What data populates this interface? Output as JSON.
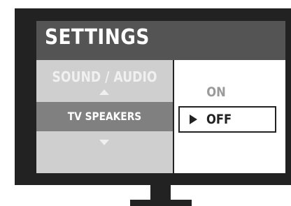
{
  "header": {
    "title": "SETTINGS"
  },
  "menu": {
    "category": "SOUND / AUDIO",
    "selected_item": "TV SPEAKERS",
    "scroll_up_icon": "triangle-up-icon",
    "scroll_down_icon": "triangle-down-icon"
  },
  "options": {
    "items": [
      {
        "label": "ON",
        "selected": false
      },
      {
        "label": "OFF",
        "selected": true
      }
    ],
    "pointer_icon": "triangle-right-icon"
  },
  "colors": {
    "bezel": "#222222",
    "header_bg": "#545454",
    "menu_bg": "#cfcfcf",
    "menu_selected_bg": "#808080",
    "option_inactive": "#9a9a9a"
  }
}
